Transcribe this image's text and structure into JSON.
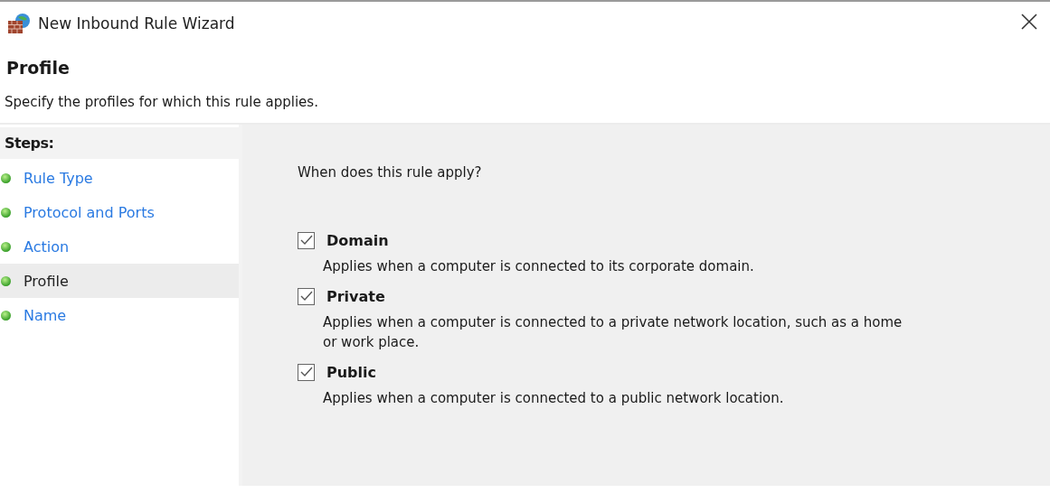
{
  "window": {
    "title": "New Inbound Rule Wizard"
  },
  "header": {
    "title": "Profile",
    "subtitle": "Specify the profiles for which this rule applies."
  },
  "steps": {
    "heading": "Steps:",
    "items": [
      {
        "label": "Rule Type",
        "selected": false
      },
      {
        "label": "Protocol and Ports",
        "selected": false
      },
      {
        "label": "Action",
        "selected": false
      },
      {
        "label": "Profile",
        "selected": true
      },
      {
        "label": "Name",
        "selected": false
      }
    ]
  },
  "content": {
    "question": "When does this rule apply?",
    "options": [
      {
        "label": "Domain",
        "checked": true,
        "description": "Applies when a computer is connected to its corporate domain."
      },
      {
        "label": "Private",
        "checked": true,
        "description": "Applies when a computer is connected to a private network location, such as a home or work place."
      },
      {
        "label": "Public",
        "checked": true,
        "description": "Applies when a computer is connected to a public network location."
      }
    ]
  }
}
